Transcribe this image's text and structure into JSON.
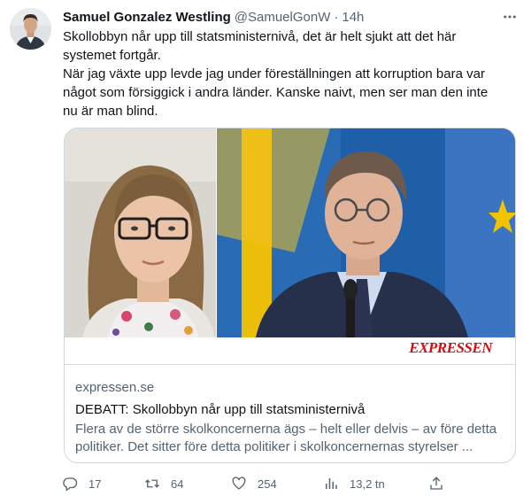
{
  "tweet": {
    "author_name": "Samuel Gonzalez Westling",
    "handle": "@SamuelGonW",
    "separator": "·",
    "time": "14h",
    "text_lines": [
      "Skollobbyn når upp till statsministernivå, det är helt sjukt att det här",
      "systemet fortgår.",
      "När jag växte upp levde jag under föreställningen att korruption bara var",
      "något som försiggick i andra länder. Kanske naivt, men ser man den inte",
      "nu är man blind."
    ]
  },
  "card": {
    "domain": "expressen.se",
    "title": "DEBATT: Skollobbyn når upp till statsministernivå",
    "description": "Flera av de större skolkoncernerna ägs – helt eller delvis – av före detta politiker. Det sitter före detta politiker i skolkoncernernas styrelser ...",
    "brand_logo": "EXPRESSEN"
  },
  "actions": {
    "replies": "17",
    "retweets": "64",
    "likes": "254",
    "views": "13,2 tn"
  },
  "icons": {
    "more": "more-icon",
    "reply": "reply-icon",
    "retweet": "retweet-icon",
    "like": "like-icon",
    "views": "views-icon",
    "share": "share-icon"
  },
  "colors": {
    "text": "#0f1419",
    "secondary": "#536471",
    "border": "#cfd9de",
    "flag_blue": "#1f5fa8",
    "flag_yellow": "#f4c300",
    "brand_red": "#d40d12"
  }
}
